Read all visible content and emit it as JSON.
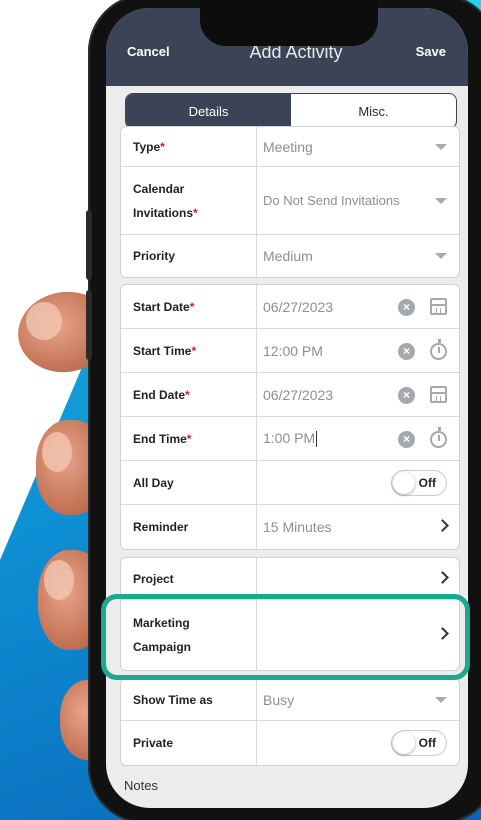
{
  "header": {
    "cancel_label": "Cancel",
    "title": "Add Activity",
    "save_label": "Save"
  },
  "tabs": [
    {
      "label": "Details",
      "active": true
    },
    {
      "label": "Misc.",
      "active": false
    }
  ],
  "group1": {
    "type": {
      "label": "Type",
      "value": "Meeting"
    },
    "invites": {
      "label_line1": "Calendar",
      "label_line2": "Invitations",
      "value": "Do Not Send Invitations"
    },
    "priority": {
      "label": "Priority",
      "value": "Medium"
    }
  },
  "group2": {
    "start_date": {
      "label": "Start Date",
      "value": "06/27/2023"
    },
    "start_time": {
      "label": "Start Time",
      "value": "12:00 PM"
    },
    "end_date": {
      "label": "End Date",
      "value": "06/27/2023"
    },
    "end_time": {
      "label": "End Time",
      "value": "1:00 PM"
    },
    "all_day": {
      "label": "All Day",
      "toggle": "Off"
    },
    "reminder": {
      "label": "Reminder",
      "value": "15 Minutes"
    }
  },
  "group3": {
    "project": {
      "label": "Project",
      "value": ""
    },
    "campaign": {
      "label_line1": "Marketing",
      "label_line2": "Campaign",
      "value": ""
    }
  },
  "group4": {
    "show_time": {
      "label": "Show Time as",
      "value": "Busy"
    },
    "private": {
      "label": "Private",
      "toggle": "Off"
    }
  },
  "notes": {
    "label": "Notes"
  },
  "required_marker": "*",
  "colors": {
    "header": "#3a4456",
    "highlight": "#1aa88e",
    "required": "#d0202e",
    "bg_accent": "#0e8fd4"
  },
  "icons": [
    "clear-icon",
    "calendar-icon",
    "clock-icon",
    "chevron-right-icon",
    "dropdown-caret-icon"
  ]
}
